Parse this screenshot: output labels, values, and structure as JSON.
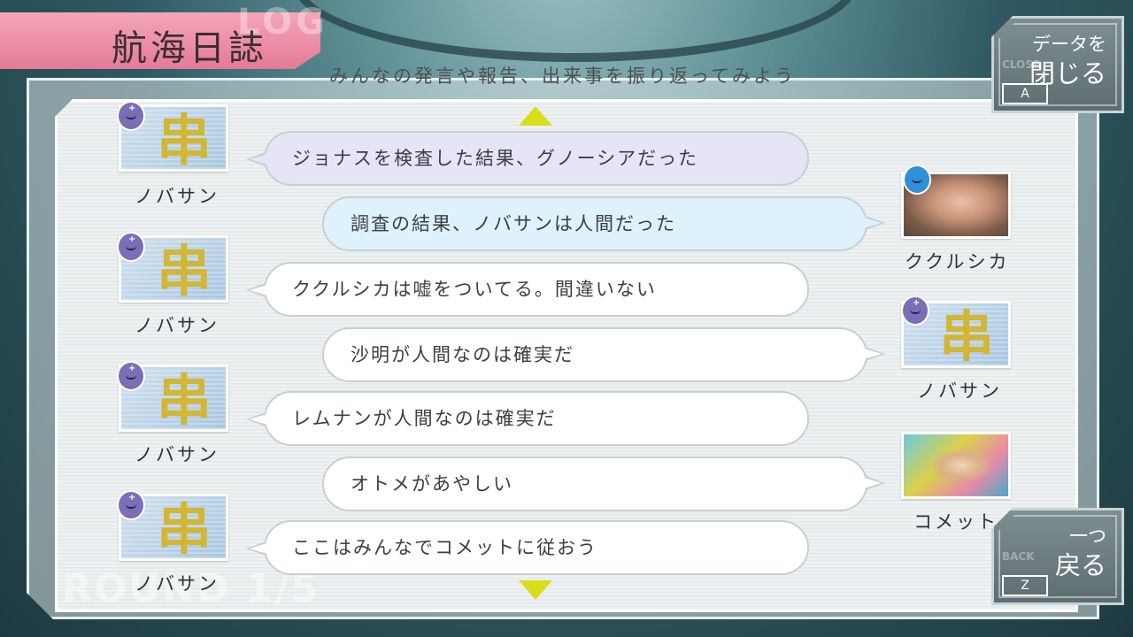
{
  "header": {
    "title": "航海日誌",
    "title_ghost": "LOG",
    "subtitle": "みんなの発言や報告、出来事を振り返ってみよう"
  },
  "close_button": {
    "line1": "データを",
    "line2": "閉じる",
    "ghost": "CLOSE",
    "key": "A"
  },
  "back_button": {
    "line1": "一つ",
    "line2": "戻る",
    "ghost": "BACK",
    "key": "Z"
  },
  "round_label": "ROUND 1/5",
  "log": [
    {
      "speaker": "ノバサン",
      "side": "left",
      "text": "ジョナスを検査した結果、グノーシアだった",
      "style": "purple",
      "role_icon": "doctor-icon"
    },
    {
      "speaker": "ククルシカ",
      "side": "right",
      "text": "調査の結果、ノバサンは人間だった",
      "style": "blue",
      "role_icon": "engineer-icon"
    },
    {
      "speaker": "ノバサン",
      "side": "left",
      "text": "ククルシカは嘘をついてる。間違いない",
      "style": "white",
      "role_icon": "doctor-icon"
    },
    {
      "speaker": "ノバサン",
      "side": "right",
      "text": "沙明が人間なのは確実だ",
      "style": "white",
      "role_icon": "doctor-icon"
    },
    {
      "speaker": "ノバサン",
      "side": "left",
      "text": "レムナンが人間なのは確実だ",
      "style": "white",
      "role_icon": "doctor-icon"
    },
    {
      "speaker": "コメット",
      "side": "right",
      "text": "オトメがあやしい",
      "style": "white",
      "role_icon": ""
    },
    {
      "speaker": "ノバサン",
      "side": "left",
      "text": "ここはみんなでコメットに従おう",
      "style": "white",
      "role_icon": "doctor-icon"
    }
  ],
  "colors": {
    "title_tab": "#e57a96",
    "arrow": "#d7df1a",
    "doctor_badge": "#7b6db6",
    "engineer_badge": "#2f8fd8",
    "bubble_purple": "#e6e4f7",
    "bubble_blue": "#ddf2fa"
  }
}
